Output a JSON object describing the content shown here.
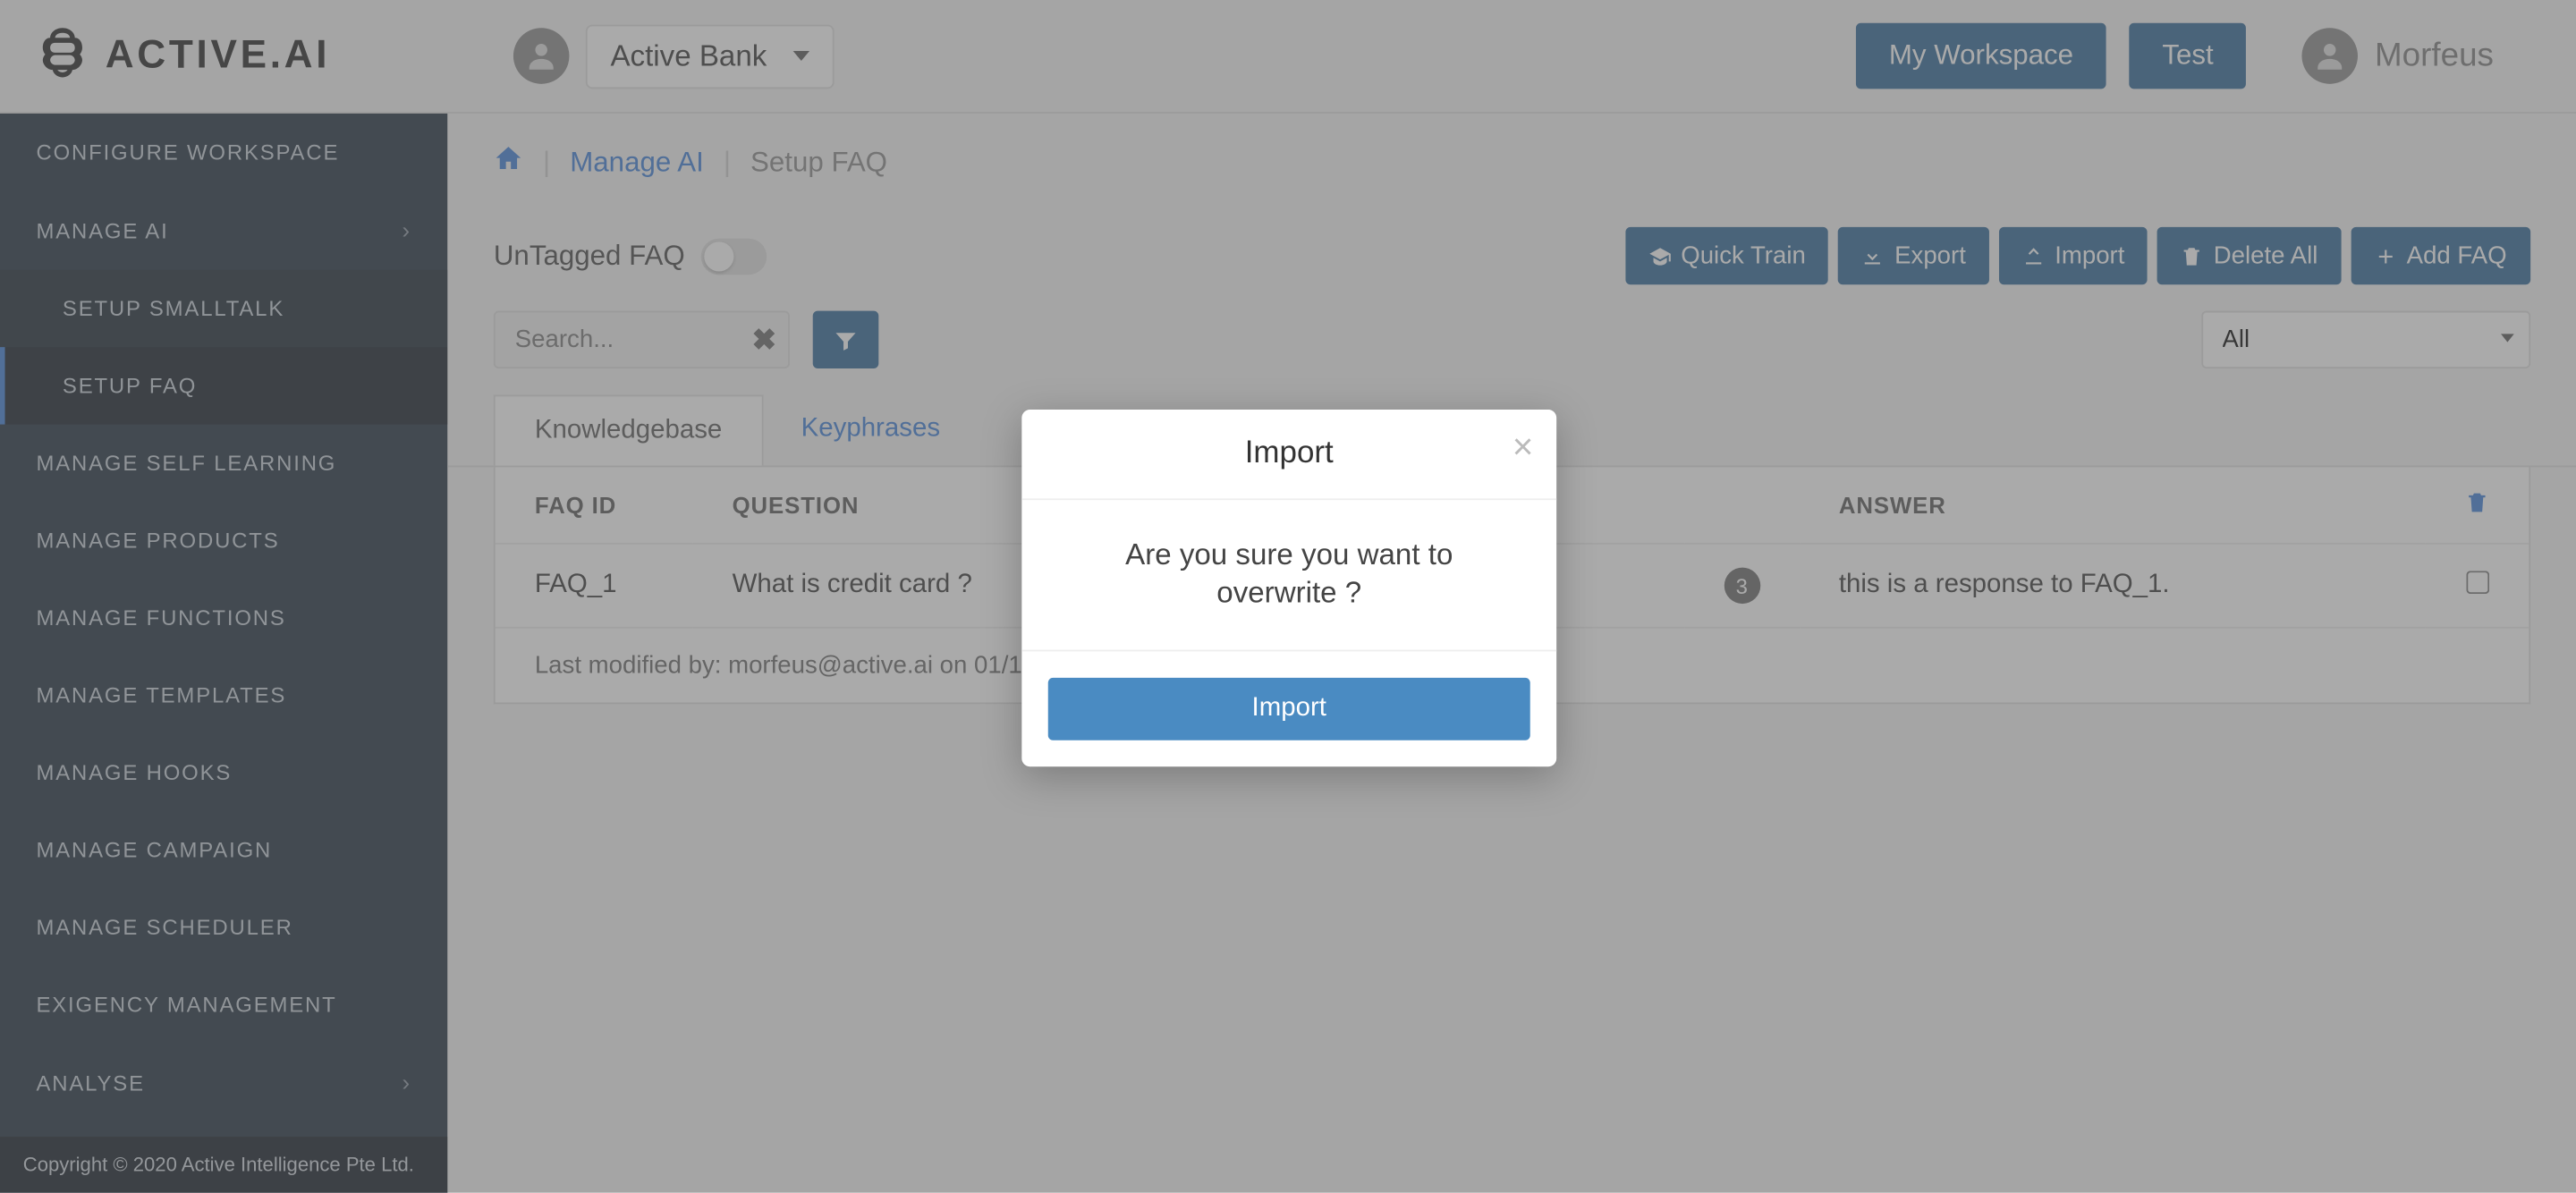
{
  "brand": {
    "text": "ACTIVE.AI"
  },
  "header": {
    "workspace": "Active Bank",
    "my_workspace": "My Workspace",
    "test": "Test",
    "user": "Morfeus"
  },
  "sidebar": {
    "items": [
      {
        "label": "CONFIGURE WORKSPACE"
      },
      {
        "label": "MANAGE AI",
        "expand": true
      },
      {
        "label": "SETUP SMALLTALK",
        "sub": true
      },
      {
        "label": "SETUP FAQ",
        "sub": true,
        "active": true
      },
      {
        "label": "MANAGE SELF LEARNING"
      },
      {
        "label": "MANAGE PRODUCTS"
      },
      {
        "label": "MANAGE FUNCTIONS"
      },
      {
        "label": "MANAGE TEMPLATES"
      },
      {
        "label": "MANAGE HOOKS"
      },
      {
        "label": "MANAGE CAMPAIGN"
      },
      {
        "label": "MANAGE SCHEDULER"
      },
      {
        "label": "EXIGENCY MANAGEMENT"
      },
      {
        "label": "ANALYSE",
        "expand": true
      }
    ],
    "footer": "Copyright © 2020 Active Intelligence Pte Ltd."
  },
  "breadcrumb": {
    "manage_ai": "Manage AI",
    "current": "Setup FAQ"
  },
  "toolbar": {
    "untagged": "UnTagged FAQ",
    "quick_train": "Quick Train",
    "export": "Export",
    "import": "Import",
    "delete_all": "Delete All",
    "add_faq": "Add FAQ"
  },
  "search": {
    "placeholder": "Search..."
  },
  "category": {
    "selected": "All"
  },
  "tabs": {
    "kb": "Knowledgebase",
    "kp": "Keyphrases"
  },
  "table": {
    "headers": {
      "id": "FAQ ID",
      "question": "QUESTION",
      "answer": "ANSWER"
    },
    "rows": [
      {
        "id": "FAQ_1",
        "question": "What is credit card ?",
        "count": "3",
        "answer": "this is a response to FAQ_1."
      }
    ],
    "last_modified": "Last modified by: morfeus@active.ai on 01/1"
  },
  "modal": {
    "title": "Import",
    "body": "Are you sure you want to overwrite ?",
    "button": "Import"
  }
}
